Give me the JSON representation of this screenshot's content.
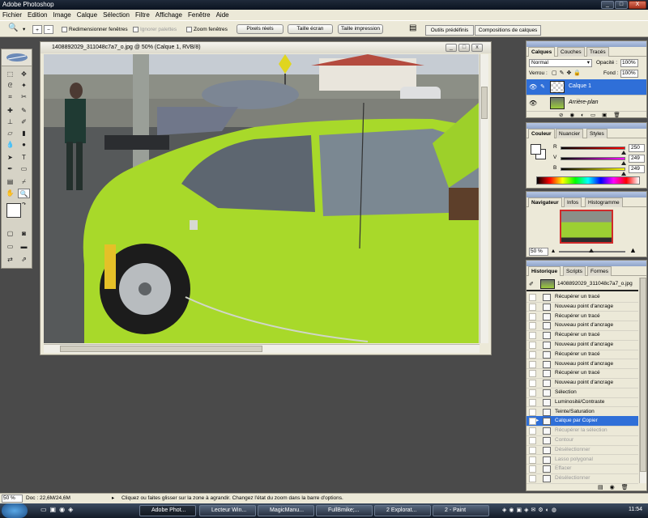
{
  "app": {
    "title": "Adobe Photoshop",
    "window_controls": [
      "_",
      "□",
      "X"
    ]
  },
  "menubar": [
    "Fichier",
    "Edition",
    "Image",
    "Calque",
    "Sélection",
    "Filtre",
    "Affichage",
    "Fenêtre",
    "Aide"
  ],
  "options_bar": {
    "resize_windows": "Redimensionner fenêtres",
    "ignore_palettes": "Ignorer palettes",
    "zoom_windows": "Zoom fenêtres",
    "actual_pixels": "Pixels réels",
    "fit_screen": "Taille écran",
    "print_size": "Taille impression",
    "tab_presets": "Outils prédéfinis",
    "tab_comps": "Compositions de calques"
  },
  "document": {
    "title": "1408892029_311048c7a7_o.jpg @ 50% (Calque 1, RVB/8)",
    "zoom_progress": 1.0
  },
  "layers_panel": {
    "tabs": [
      "Calques",
      "Couches",
      "Tracés"
    ],
    "blend_mode": "Normal",
    "opacity_label": "Opacité :",
    "opacity": "100%",
    "lock_label": "Verrou :",
    "fill_label": "Fond :",
    "fill": "100%",
    "layers": [
      {
        "name": "Calque 1",
        "selected": true
      },
      {
        "name": "Arrière-plan",
        "selected": false
      }
    ]
  },
  "color_panel": {
    "tabs": [
      "Couleur",
      "Nuancier",
      "Styles"
    ],
    "channels": [
      {
        "label": "R",
        "value": "250",
        "fraction": 0.98,
        "color": "#ff0000"
      },
      {
        "label": "V",
        "value": "249",
        "fraction": 0.976,
        "color": "#ff00ff"
      },
      {
        "label": "B",
        "value": "249",
        "fraction": 0.976,
        "color": "#ffff00"
      }
    ]
  },
  "navigator_panel": {
    "tabs": [
      "Navigateur",
      "Infos",
      "Histogramme"
    ],
    "zoom": "50 %"
  },
  "history_panel": {
    "tabs": [
      "Historique",
      "Scripts",
      "Formes"
    ],
    "snapshot": "1408892029_311048c7a7_o.jpg",
    "items": [
      {
        "label": "Récupérer un tracé",
        "state": "normal"
      },
      {
        "label": "Nouveau point d'ancrage",
        "state": "normal"
      },
      {
        "label": "Récupérer un tracé",
        "state": "normal"
      },
      {
        "label": "Nouveau point d'ancrage",
        "state": "normal"
      },
      {
        "label": "Récupérer un tracé",
        "state": "normal"
      },
      {
        "label": "Nouveau point d'ancrage",
        "state": "normal"
      },
      {
        "label": "Récupérer un tracé",
        "state": "normal"
      },
      {
        "label": "Nouveau point d'ancrage",
        "state": "normal"
      },
      {
        "label": "Récupérer un tracé",
        "state": "normal"
      },
      {
        "label": "Nouveau point d'ancrage",
        "state": "normal"
      },
      {
        "label": "Sélection",
        "state": "normal"
      },
      {
        "label": "Luminosité/Contraste",
        "state": "normal"
      },
      {
        "label": "Teinte/Saturation",
        "state": "normal"
      },
      {
        "label": "Calque par Copier",
        "state": "selected"
      },
      {
        "label": "Récupérer la sélection",
        "state": "dim"
      },
      {
        "label": "Contour",
        "state": "dim"
      },
      {
        "label": "Désélectionner",
        "state": "dim"
      },
      {
        "label": "Lasso polygonal",
        "state": "dim"
      },
      {
        "label": "Effacer",
        "state": "dim"
      },
      {
        "label": "Désélectionner",
        "state": "dim"
      }
    ]
  },
  "status_bar": {
    "zoom": "50 %",
    "doc": "Doc : 22,6M/24,6M",
    "hint": "Cliquez ou faites glisser sur la zone à agrandir. Changez l'état du zoom dans la barre d'options."
  },
  "taskbar": {
    "tasks": [
      {
        "label": "Adobe Phot...",
        "active": true
      },
      {
        "label": "Lecteur Win...",
        "active": false
      },
      {
        "label": "MagicManu...",
        "active": false
      },
      {
        "label": "FullBmike;...",
        "active": false
      },
      {
        "label": "2 Explorat...",
        "active": false
      },
      {
        "label": "2 - Paint",
        "active": false
      }
    ],
    "clock": "11:54"
  }
}
